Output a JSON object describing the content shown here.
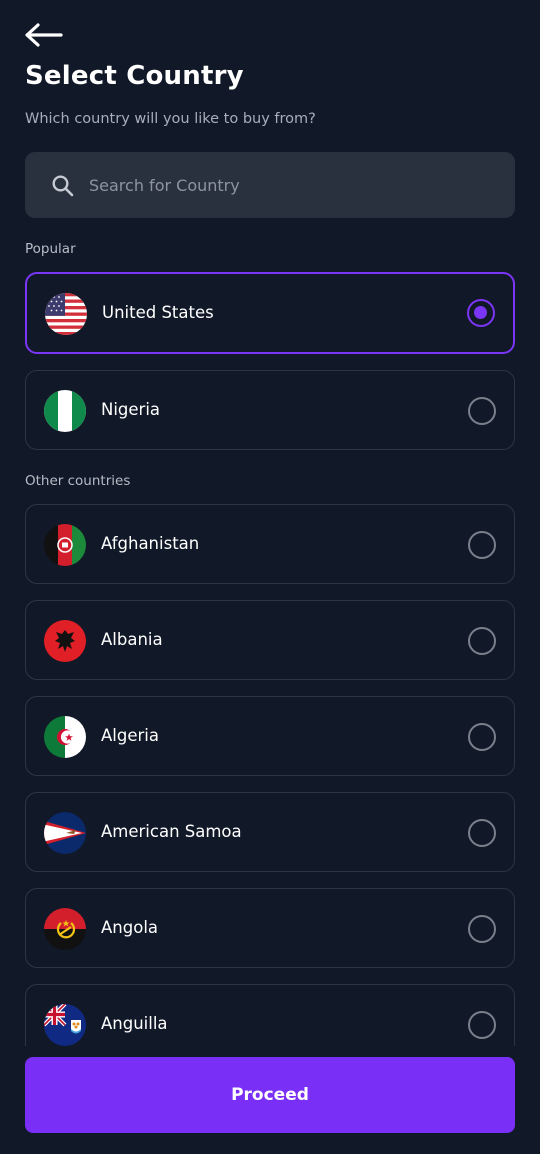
{
  "header": {
    "back_icon": "arrow-left-icon",
    "title": "Select Country",
    "subtitle": "Which country will you like to buy from?"
  },
  "search": {
    "icon": "search-icon",
    "placeholder": "Search for Country",
    "value": ""
  },
  "sections": {
    "popular_label": "Popular",
    "other_label": "Other countries"
  },
  "popular": [
    {
      "name": "United States",
      "flag": "us-flag-icon",
      "selected": true
    },
    {
      "name": "Nigeria",
      "flag": "nigeria-flag-icon",
      "selected": false
    }
  ],
  "other": [
    {
      "name": "Afghanistan",
      "flag": "afghanistan-flag-icon",
      "selected": false
    },
    {
      "name": "Albania",
      "flag": "albania-flag-icon",
      "selected": false
    },
    {
      "name": "Algeria",
      "flag": "algeria-flag-icon",
      "selected": false
    },
    {
      "name": "American Samoa",
      "flag": "american-samoa-flag-icon",
      "selected": false
    },
    {
      "name": "Angola",
      "flag": "angola-flag-icon",
      "selected": false
    },
    {
      "name": "Anguilla",
      "flag": "anguilla-flag-icon",
      "selected": false
    }
  ],
  "footer": {
    "proceed_label": "Proceed"
  },
  "colors": {
    "background": "#111827",
    "accent": "#7b35f6",
    "card_border": "#2e3542",
    "search_bg": "#2a313e"
  }
}
